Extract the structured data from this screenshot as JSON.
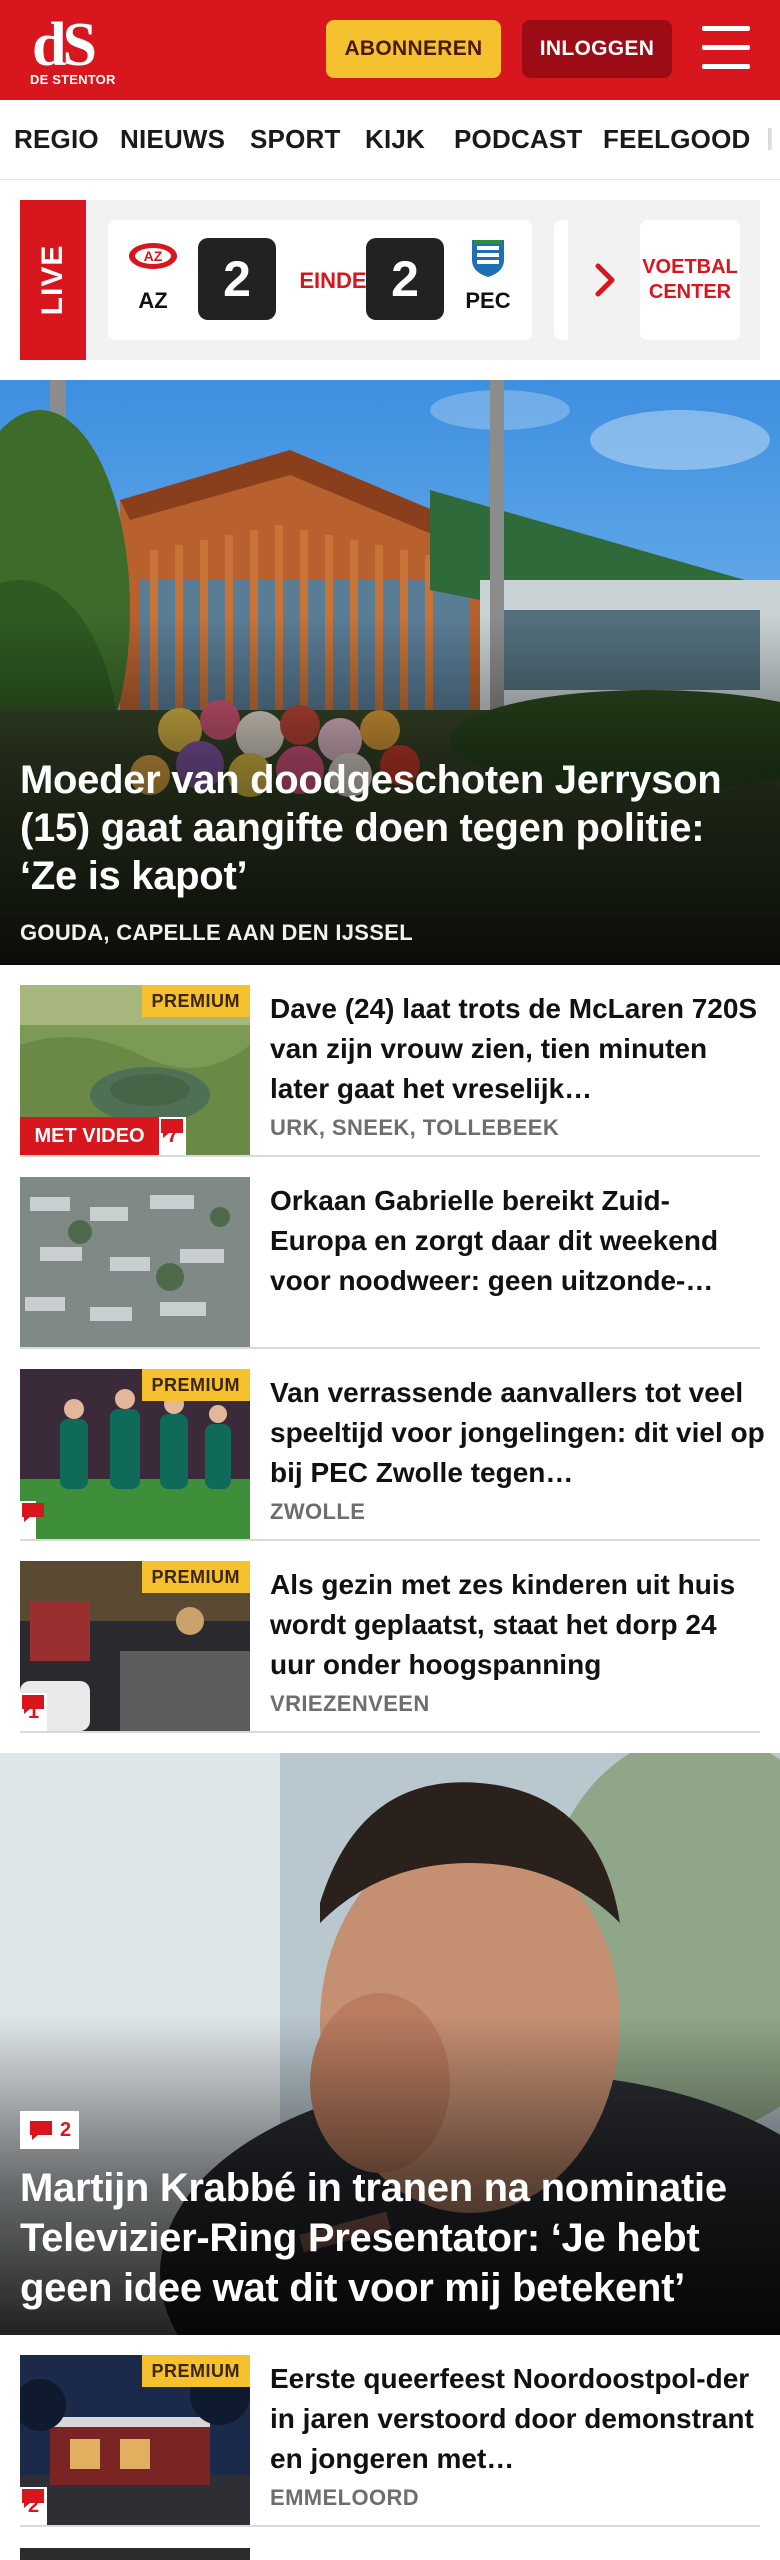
{
  "header": {
    "logo_mark": "dS",
    "logo_text": "DE STENTOR",
    "subscribe_label": "ABONNEREN",
    "login_label": "INLOGGEN",
    "menu_icon": "hamburger-menu-icon",
    "brand_color": "#d7161e",
    "accent_color": "#f6c12e"
  },
  "nav": {
    "items": [
      "REGIO",
      "NIEUWS",
      "SPORT",
      "KIJK",
      "PODCAST",
      "FEELGOOD"
    ]
  },
  "live": {
    "label": "LIVE",
    "match": {
      "home_team": "AZ",
      "home_score": "2",
      "status": "EINDE",
      "away_score": "2",
      "away_team": "PEC"
    },
    "center_link": "VOETBAL CENTER"
  },
  "hero": {
    "title": "Moeder van doodgeschoten Jerryson (15) gaat aangifte doen tegen politie: ‘Ze is kapot’",
    "location": "GOUDA, CAPELLE AAN DEN IJSSEL"
  },
  "articles": [
    {
      "title": "Dave (24) laat trots de McLaren 720S van zijn vrouw zien, tien minuten later gaat het vreselijk…",
      "location": "URK, SNEEK, TOLLEBEEK",
      "premium": "PREMIUM",
      "video": "MET VIDEO",
      "comments": "7"
    },
    {
      "title": "Orkaan Gabrielle bereikt Zuid-Europa en zorgt daar dit weekend voor noodweer: geen uitzonde-…",
      "location": "",
      "premium": "",
      "video": "",
      "comments": ""
    },
    {
      "title": "Van verrassende aanvallers tot veel speeltijd voor jongelingen: dit viel op bij PEC Zwolle tegen…",
      "location": "ZWOLLE",
      "premium": "PREMIUM",
      "video": "",
      "comments": ""
    },
    {
      "title": "Als gezin met zes kinderen uit huis wordt geplaatst, staat het dorp 24 uur onder hoogspanning",
      "location": "VRIEZENVEEN",
      "premium": "PREMIUM",
      "video": "",
      "comments": "1"
    }
  ],
  "feature": {
    "title": "Martijn Krabbé in tranen na nominatie Televizier-Ring Presentator: ‘Je hebt geen idee wat dit voor mij betekent’",
    "comments": "2"
  },
  "article_after": {
    "title": "Eerste queerfeest Noordoostpol-der in jaren verstoord door demonstrant en jongeren met…",
    "location": "EMMELOORD",
    "premium": "PREMIUM",
    "comments": "2"
  }
}
